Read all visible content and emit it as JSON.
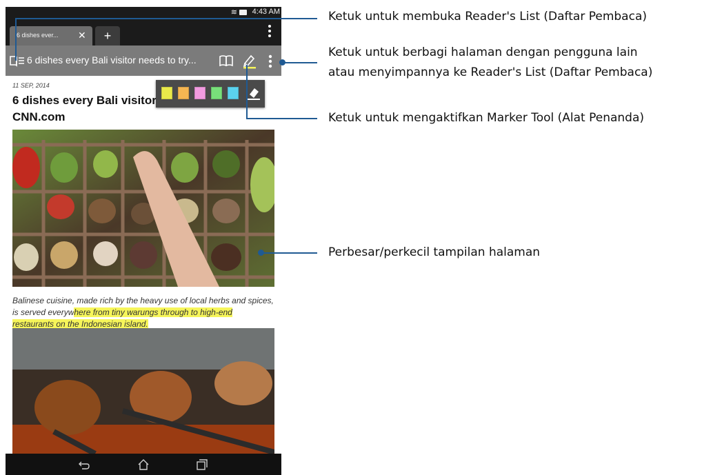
{
  "status_bar": {
    "time": "4:43 AM"
  },
  "tabs": [
    {
      "label": "6 dishes ever...",
      "close_glyph": "✕"
    }
  ],
  "new_tab_glyph": "+",
  "toolbar": {
    "page_title": "6 dishes every Bali visitor needs to try..."
  },
  "article": {
    "date": "11 SEP, 2014",
    "headline": "6 dishes every Bali visitor needs to try CNN.com",
    "caption_plain": "Balinese cuisine, made rich by the heavy use of local herbs and spices, is served everyw",
    "caption_highlight": "here from tiny warungs through to high-end restaurants on the Indonesian island."
  },
  "marker_colors": [
    "#e9e94a",
    "#f5b652",
    "#f29be0",
    "#78e07a",
    "#5bd2ee"
  ],
  "icons": {
    "reader_list": "book-list-icon",
    "reader_mode": "open-book-icon",
    "marker_tool": "marker-pen-icon",
    "overflow": "kebab-menu-icon",
    "eraser": "eraser-icon",
    "nav_back": "back-icon",
    "nav_home": "home-icon",
    "nav_recents": "recents-icon"
  },
  "callouts": {
    "reader_list": "Ketuk untuk membuka Reader's List (Daftar Pembaca)",
    "share_line1": "Ketuk untuk berbagi halaman dengan pengguna lain",
    "share_line2": "atau menyimpannya ke Reader's List (Daftar Pembaca)",
    "marker": "Ketuk untuk mengaktifkan Marker Tool (Alat Penanda)",
    "zoom": "Perbesar/perkecil tampilan halaman"
  },
  "accent_color": "#1f5a93"
}
